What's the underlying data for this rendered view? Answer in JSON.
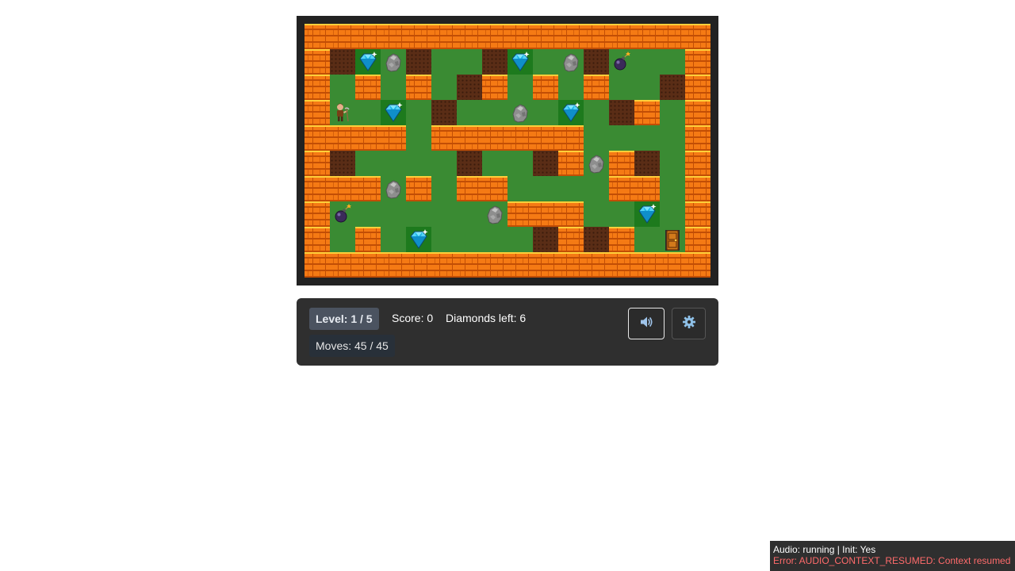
{
  "hud": {
    "level": "Level: 1 / 5",
    "score": "Score: 0",
    "diamonds_left": "Diamonds left: 6",
    "moves": "Moves: 45 / 45"
  },
  "buttons": {
    "sound_icon": "speaker-icon",
    "settings_icon": "gear-icon"
  },
  "debug": {
    "status": "Audio: running | Init: Yes",
    "error": "Error: AUDIO_CONTEXT_RESUMED: Context resumed"
  },
  "board": {
    "legend": {
      "B": "brick-wall",
      "G": "grass",
      "D": "dirt",
      "C": "diamond",
      "R": "boulder",
      "P": "player",
      "X": "bomb",
      "E": "exit-door"
    },
    "rows": [
      "BBBBBBBBBBBBBBBB",
      "BDCRDGGDCGRDXGGB",
      "BGBGBGDBGBGBGGDB",
      "BPGCGDGGRGCGDBGB",
      "BBBBGBBBBBBGGGGB",
      "BDGGGGDGGDBRBDGB",
      "BBBRBGBBGGGGBBGB",
      "BXGGGGGRBBBGGCGB",
      "BGBGCGGGGDBDBGEB",
      "BBBBBBBBBBBBBBBB"
    ]
  },
  "colors": {
    "grass": "#3a8b33",
    "brick": "#f57a14",
    "dirt": "#5a2d16",
    "diamond": "#22c4f0",
    "panel": "#2f2f2f",
    "error_text": "#ff6b6b"
  }
}
